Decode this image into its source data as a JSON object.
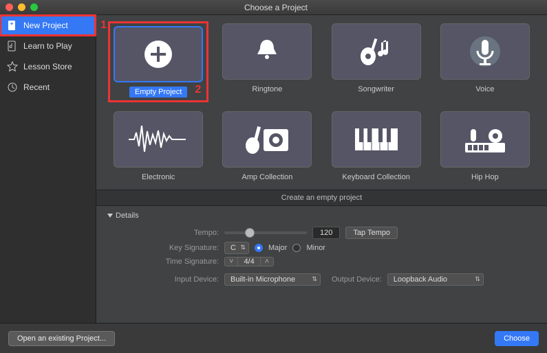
{
  "window": {
    "title": "Choose a Project"
  },
  "sidebar": {
    "items": [
      {
        "label": "New Project",
        "icon": "plus-doc",
        "selected": true
      },
      {
        "label": "Learn to Play",
        "icon": "note-doc",
        "selected": false
      },
      {
        "label": "Lesson Store",
        "icon": "star",
        "selected": false
      },
      {
        "label": "Recent",
        "icon": "clock",
        "selected": false
      }
    ]
  },
  "annotations": {
    "sidebar_num": "1",
    "template_num": "2"
  },
  "templates": [
    {
      "label": "Empty Project",
      "icon": "plus-circle",
      "selected": true
    },
    {
      "label": "Ringtone",
      "icon": "bell",
      "selected": false
    },
    {
      "label": "Songwriter",
      "icon": "guitar",
      "selected": false
    },
    {
      "label": "Voice",
      "icon": "mic",
      "selected": false
    },
    {
      "label": "Electronic",
      "icon": "wave",
      "selected": false
    },
    {
      "label": "Amp Collection",
      "icon": "amp",
      "selected": false
    },
    {
      "label": "Keyboard Collection",
      "icon": "keys",
      "selected": false
    },
    {
      "label": "Hip Hop",
      "icon": "hiphop",
      "selected": false
    }
  ],
  "description": "Create an empty project",
  "details": {
    "toggle_label": "Details",
    "tempo_label": "Tempo:",
    "tempo_value": "120",
    "tap_tempo": "Tap Tempo",
    "key_label": "Key Signature:",
    "key_value": "C",
    "scale_major": "Major",
    "scale_minor": "Minor",
    "scale_selected": "major",
    "time_label": "Time Signature:",
    "time_value": "4/4",
    "input_label": "Input Device:",
    "input_value": "Built-in Microphone",
    "output_label": "Output Device:",
    "output_value": "Loopback Audio"
  },
  "footer": {
    "open_existing": "Open an existing Project...",
    "choose": "Choose"
  }
}
